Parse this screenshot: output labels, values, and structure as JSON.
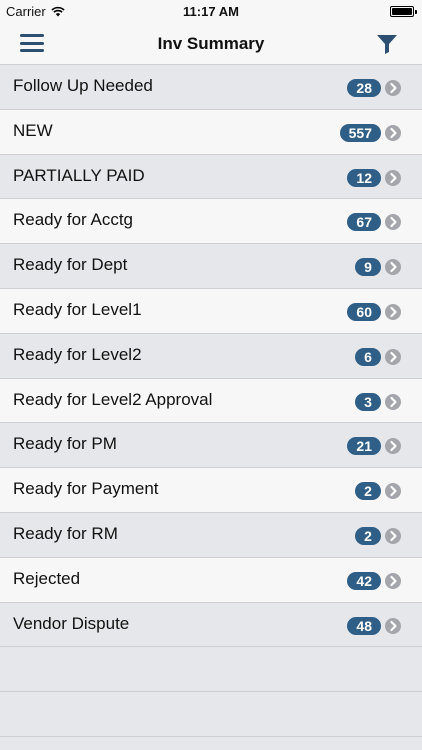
{
  "status_bar": {
    "carrier": "Carrier",
    "time": "11:17 AM"
  },
  "header": {
    "title": "Inv Summary"
  },
  "items": [
    {
      "label": "Follow Up Needed",
      "count": "28"
    },
    {
      "label": "NEW",
      "count": "557"
    },
    {
      "label": "PARTIALLY PAID",
      "count": "12"
    },
    {
      "label": "Ready for Acctg",
      "count": "67"
    },
    {
      "label": "Ready for Dept",
      "count": "9"
    },
    {
      "label": "Ready for Level1",
      "count": "60"
    },
    {
      "label": "Ready for Level2",
      "count": "6"
    },
    {
      "label": "Ready for Level2 Approval",
      "count": "3"
    },
    {
      "label": "Ready for PM",
      "count": "21"
    },
    {
      "label": "Ready for Payment",
      "count": "2"
    },
    {
      "label": "Ready for RM",
      "count": "2"
    },
    {
      "label": "Rejected",
      "count": "42"
    },
    {
      "label": "Vendor Dispute",
      "count": "48"
    }
  ],
  "colors": {
    "accent": "#2f5f86",
    "icon": "#2c4f72",
    "chevron": "#a4a6ab"
  }
}
